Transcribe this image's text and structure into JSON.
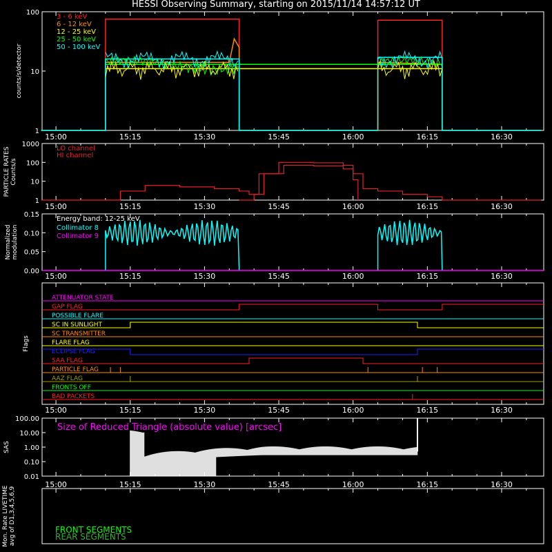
{
  "title": "HESSI Observing Summary, starting on 2015/11/14 14:57:12 UT",
  "time_ticks": [
    "15:00",
    "15:15",
    "15:30",
    "15:45",
    "16:00",
    "16:15",
    "16:30"
  ],
  "colors": {
    "red": "#ff2020",
    "orange": "#ff8c00",
    "yellow": "#ffff00",
    "green": "#00ff00",
    "cyan": "#00ffff",
    "magenta": "#ff00ff",
    "crimson": "#e8202a",
    "blue": "#2020ff",
    "white": "#ffffff",
    "darkgreen": "#30b030"
  },
  "chart_data": [
    {
      "type": "line",
      "id": "counts",
      "ylabel": "counts/s/detector",
      "ytick_labels": [
        "1",
        "10",
        "100"
      ],
      "ylim": [
        1,
        100
      ],
      "yscale": "log",
      "legend_placement": "top-left",
      "series": [
        {
          "name": "3 - 6 keV",
          "color": "red",
          "x": [
            "14:57",
            "15:10",
            "15:10",
            "15:37",
            "15:37",
            "16:05",
            "16:05",
            "16:18",
            "16:18",
            "16:38"
          ],
          "y": [
            1,
            1,
            75,
            75,
            1,
            1,
            72,
            72,
            1,
            1
          ]
        },
        {
          "name": "6 - 12 keV",
          "color": "orange",
          "x": [
            "14:57",
            "15:10",
            "15:10",
            "15:35",
            "15:36",
            "15:37",
            "15:37",
            "16:05",
            "16:05",
            "16:18",
            "16:18",
            "16:38"
          ],
          "y": [
            1,
            1,
            14,
            14,
            35,
            25,
            1,
            1,
            14,
            13,
            1,
            1
          ]
        },
        {
          "name": "12 - 25 keV",
          "color": "yellow",
          "x": [
            "15:10",
            "15:37",
            "16:05",
            "16:18"
          ],
          "y": [
            11,
            11,
            11,
            11
          ]
        },
        {
          "name": "25 - 50 keV",
          "color": "green",
          "x": [
            "15:10",
            "15:37",
            "16:05",
            "16:18"
          ],
          "y": [
            13,
            13,
            13,
            13
          ]
        },
        {
          "name": "50 - 100 keV",
          "color": "cyan",
          "x": [
            "14:57",
            "15:10",
            "15:10",
            "15:37",
            "15:37",
            "16:05",
            "16:05",
            "16:18",
            "16:18",
            "16:38"
          ],
          "y": [
            1,
            1,
            16,
            16,
            1,
            1,
            17,
            17,
            1,
            1
          ]
        }
      ]
    },
    {
      "type": "line",
      "id": "particle",
      "ylabel_lines": [
        "PARTICLE RATES",
        "Counts/s"
      ],
      "ytick_labels": [
        "1",
        "10",
        "100",
        "1000"
      ],
      "ylim": [
        1,
        1000
      ],
      "yscale": "log",
      "legend_placement": "top-left",
      "series": [
        {
          "name": "LO channel",
          "color": "crimson",
          "x": [
            "14:57",
            "15:10",
            "15:13",
            "15:18",
            "15:25",
            "15:32",
            "15:37",
            "15:39",
            "15:41",
            "15:45",
            "15:52",
            "15:58",
            "16:00",
            "16:02",
            "16:05",
            "16:10",
            "16:15",
            "16:18",
            "16:38"
          ],
          "y": [
            1,
            1,
            3,
            6,
            5,
            4,
            3,
            2,
            25,
            100,
            95,
            70,
            25,
            4,
            3,
            2,
            1.5,
            1,
            1
          ]
        },
        {
          "name": "HI channel",
          "color": "crimson",
          "x": [
            "15:37",
            "15:40",
            "15:42",
            "15:46",
            "15:52",
            "15:58",
            "16:00",
            "16:01"
          ],
          "y": [
            1,
            2,
            25,
            70,
            65,
            45,
            12,
            1
          ]
        }
      ]
    },
    {
      "type": "line",
      "id": "modulation",
      "ylabel_lines": [
        "Normalized",
        "modulation"
      ],
      "ytick_labels": [
        "0.00",
        "0.05",
        "0.10",
        "0.15"
      ],
      "ylim": [
        0,
        0.15
      ],
      "legend_placement": "top-left",
      "legend_header": "Energy band: 12-25 keV",
      "series": [
        {
          "name": "Collimator 8",
          "color": "cyan",
          "x": [
            "15:10",
            "15:37",
            "16:05",
            "16:18"
          ],
          "y": [
            0.1,
            0.1,
            0.1,
            0.1
          ]
        },
        {
          "name": "Collimator 9",
          "color": "magenta",
          "x": [
            "14:57",
            "16:38"
          ],
          "y": [
            0,
            0
          ]
        }
      ]
    },
    {
      "type": "line",
      "id": "flags",
      "ylabel": "Flags",
      "series": [
        {
          "name": "ATTENUATOR STATE",
          "color": "magenta",
          "steps": [
            [
              "14:57",
              0
            ],
            [
              "16:38",
              0
            ]
          ]
        },
        {
          "name": "GAP FLAG",
          "color": "red",
          "steps": [
            [
              "14:57",
              0
            ],
            [
              "15:37",
              1
            ],
            [
              "16:05",
              0
            ],
            [
              "16:18",
              1
            ]
          ]
        },
        {
          "name": "POSSIBLE FLARE",
          "color": "cyan",
          "steps": [
            [
              "14:57",
              0
            ]
          ]
        },
        {
          "name": "SC IN SUNLIGHT",
          "color": "yellow",
          "steps": [
            [
              "14:57",
              0
            ],
            [
              "15:15",
              1
            ],
            [
              "16:13",
              0
            ]
          ]
        },
        {
          "name": "SC TRANSMITTER",
          "color": "orange",
          "steps": [
            [
              "14:57",
              0
            ]
          ]
        },
        {
          "name": "FLARE FLAG",
          "color": "yellow",
          "steps": [
            [
              "14:57",
              0
            ]
          ]
        },
        {
          "name": "ECLIPSE FLAG",
          "color": "blue",
          "steps": [
            [
              "14:57",
              1
            ],
            [
              "15:15",
              0
            ],
            [
              "16:13",
              1
            ]
          ]
        },
        {
          "name": "SAA FLAG",
          "color": "red",
          "steps": [
            [
              "14:57",
              0
            ],
            [
              "15:39",
              1
            ],
            [
              "16:02",
              0
            ]
          ]
        },
        {
          "name": "PARTICLE FLAG",
          "color": "orange",
          "steps": [
            [
              "14:57",
              0
            ]
          ],
          "spikes": [
            "15:11",
            "15:13",
            "16:03",
            "16:14",
            "16:17"
          ]
        },
        {
          "name": "AAZ FLAG",
          "color": "olive",
          "steps": [
            [
              "14:57",
              0
            ]
          ],
          "spikes": [
            "15:15",
            "16:13"
          ]
        },
        {
          "name": "FRONTS OFF",
          "color": "green",
          "steps": [
            [
              "14:57",
              0
            ]
          ]
        },
        {
          "name": "BAD PACKETS",
          "color": "red",
          "steps": [
            [
              "14:57",
              0
            ]
          ],
          "spikes": [
            "16:12"
          ]
        }
      ]
    },
    {
      "type": "line",
      "id": "sas",
      "ylabel": "SAS",
      "ytick_labels": [
        "0.01",
        "0.10",
        "1.00",
        "10.00",
        "100.00"
      ],
      "ylim": [
        0.01,
        100
      ],
      "yscale": "log",
      "annotation": "Size of Reduced Triangle (absolute value) [arcsec]",
      "series": [
        {
          "name": "",
          "color": "white",
          "x": [
            "15:15",
            "15:16",
            "15:20",
            "15:25",
            "15:30",
            "15:35",
            "15:40",
            "15:50",
            "16:00",
            "16:12",
            "16:13"
          ],
          "y": [
            60,
            0.3,
            0.15,
            0.2,
            0.35,
            0.6,
            0.7,
            0.7,
            0.7,
            0.7,
            100
          ]
        }
      ]
    },
    {
      "type": "line",
      "id": "livetime",
      "ylabel_lines": [
        "Mon. Rate LIVETIME",
        "avg of D1,3,4,5,6,9"
      ],
      "series": [
        {
          "name": "FRONT SEGMENTS",
          "color": "green"
        },
        {
          "name": "REAR SEGMENTS",
          "color": "darkgreen"
        }
      ]
    }
  ]
}
